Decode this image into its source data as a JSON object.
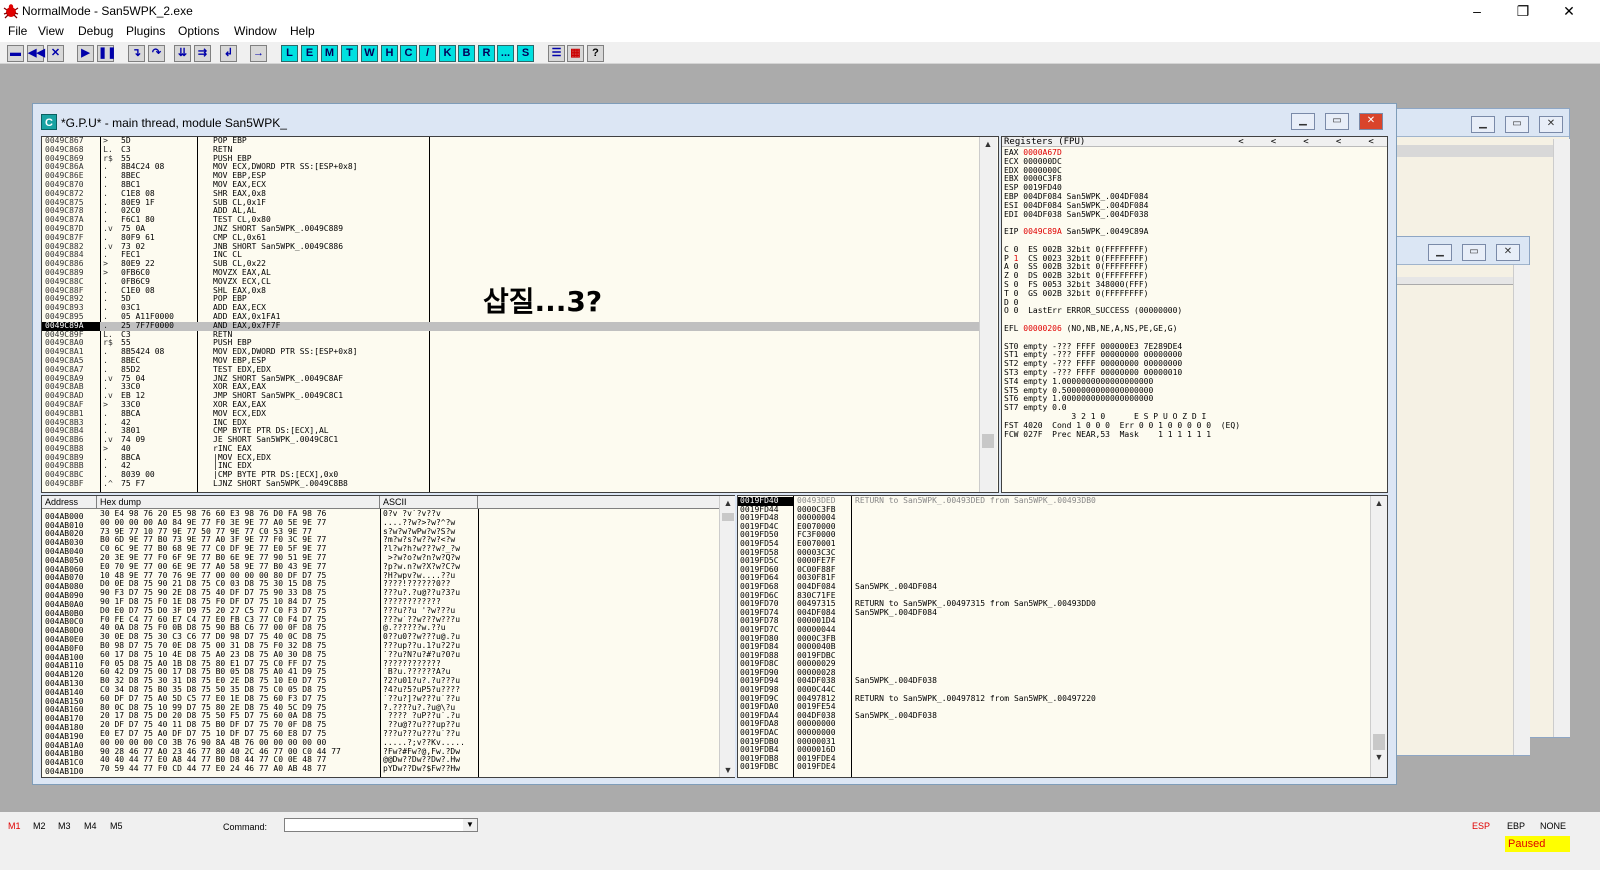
{
  "window": {
    "title": "NormalMode - San5WPK_2.exe",
    "minimize": "–",
    "maximize": "❐",
    "close": "✕"
  },
  "menu": [
    "File",
    "View",
    "Debug",
    "Plugins",
    "Options",
    "Window",
    "Help"
  ],
  "toolbar": {
    "left_buttons": [
      "open-icon",
      "rewind-icon",
      "close-icon",
      "run-icon",
      "pause-icon",
      "step-into-icon",
      "step-over-icon",
      "trace-into-icon",
      "trace-over-icon",
      "execute-till-return-icon",
      "go-to-icon"
    ],
    "letters": [
      "L",
      "E",
      "M",
      "T",
      "W",
      "H",
      "C",
      "/",
      "K",
      "B",
      "R",
      "...",
      "S"
    ],
    "right_buttons": [
      "list-icon",
      "grid-icon",
      "help-icon"
    ],
    "help_label": "?"
  },
  "cpu_window": {
    "title": "*G.P.U* - main thread, module San5WPK_",
    "icon_letter": "C"
  },
  "overlay_text": "삽질...3?",
  "disasm": [
    {
      "addr": "0049C867",
      "arrow": "> ",
      "hex": "5D",
      "asm": "POP EBP"
    },
    {
      "addr": "0049C868",
      "arrow": "L.",
      "hex": "C3",
      "asm": "RETN"
    },
    {
      "addr": "0049C869",
      "arrow": "r$",
      "hex": "55",
      "asm": "PUSH EBP"
    },
    {
      "addr": "0049C86A",
      "arrow": ". ",
      "hex": "8B4C24 08",
      "asm": "MOV ECX,DWORD PTR SS:[ESP+0x8]"
    },
    {
      "addr": "0049C86E",
      "arrow": ". ",
      "hex": "8BEC",
      "asm": "MOV EBP,ESP"
    },
    {
      "addr": "0049C870",
      "arrow": ". ",
      "hex": "8BC1",
      "asm": "MOV EAX,ECX"
    },
    {
      "addr": "0049C872",
      "arrow": ". ",
      "hex": "C1E8 08",
      "asm": "SHR EAX,0x8"
    },
    {
      "addr": "0049C875",
      "arrow": ". ",
      "hex": "80E9 1F",
      "asm": "SUB CL,0x1F"
    },
    {
      "addr": "0049C878",
      "arrow": ". ",
      "hex": "02C0",
      "asm": "ADD AL,AL"
    },
    {
      "addr": "0049C87A",
      "arrow": ". ",
      "hex": "F6C1 80",
      "asm": "TEST CL,0x80"
    },
    {
      "addr": "0049C87D",
      "arrow": ".v",
      "hex": "75 0A",
      "asm": "JNZ SHORT San5WPK_.0049C889"
    },
    {
      "addr": "0049C87F",
      "arrow": ". ",
      "hex": "80F9 61",
      "asm": "CMP CL,0x61"
    },
    {
      "addr": "0049C882",
      "arrow": ".v",
      "hex": "73 02",
      "asm": "JNB SHORT San5WPK_.0049C886"
    },
    {
      "addr": "0049C884",
      "arrow": ". ",
      "hex": "FEC1",
      "asm": "INC CL"
    },
    {
      "addr": "0049C886",
      "arrow": "> ",
      "hex": "80E9 22",
      "asm": "SUB CL,0x22"
    },
    {
      "addr": "0049C889",
      "arrow": "> ",
      "hex": "0FB6C0",
      "asm": "MOVZX EAX,AL"
    },
    {
      "addr": "0049C88C",
      "arrow": ". ",
      "hex": "0FB6C9",
      "asm": "MOVZX ECX,CL"
    },
    {
      "addr": "0049C88F",
      "arrow": ". ",
      "hex": "C1E0 08",
      "asm": "SHL EAX,0x8"
    },
    {
      "addr": "0049C892",
      "arrow": ". ",
      "hex": "5D",
      "asm": "POP EBP"
    },
    {
      "addr": "0049C893",
      "arrow": ". ",
      "hex": "03C1",
      "asm": "ADD EAX,ECX"
    },
    {
      "addr": "0049C895",
      "arrow": ". ",
      "hex": "05 A11F0000",
      "asm": "ADD EAX,0x1FA1"
    },
    {
      "addr": "0049C89A",
      "arrow": ". ",
      "hex": "25 7F7F0000",
      "asm": "AND EAX,0x7F7F",
      "sel": true
    },
    {
      "addr": "0049C89F",
      "arrow": "L.",
      "hex": "C3",
      "asm": "RETN"
    },
    {
      "addr": "0049C8A0",
      "arrow": "r$",
      "hex": "55",
      "asm": "PUSH EBP"
    },
    {
      "addr": "0049C8A1",
      "arrow": ". ",
      "hex": "8B5424 08",
      "asm": "MOV EDX,DWORD PTR SS:[ESP+0x8]"
    },
    {
      "addr": "0049C8A5",
      "arrow": ". ",
      "hex": "8BEC",
      "asm": "MOV EBP,ESP"
    },
    {
      "addr": "0049C8A7",
      "arrow": ". ",
      "hex": "85D2",
      "asm": "TEST EDX,EDX"
    },
    {
      "addr": "0049C8A9",
      "arrow": ".v",
      "hex": "75 04",
      "asm": "JNZ SHORT San5WPK_.0049C8AF"
    },
    {
      "addr": "0049C8AB",
      "arrow": ". ",
      "hex": "33C0",
      "asm": "XOR EAX,EAX"
    },
    {
      "addr": "0049C8AD",
      "arrow": ".v",
      "hex": "EB 12",
      "asm": "JMP SHORT San5WPK_.0049C8C1"
    },
    {
      "addr": "0049C8AF",
      "arrow": "> ",
      "hex": "33C0",
      "asm": "XOR EAX,EAX"
    },
    {
      "addr": "0049C8B1",
      "arrow": ". ",
      "hex": "8BCA",
      "asm": "MOV ECX,EDX"
    },
    {
      "addr": "0049C8B3",
      "arrow": ". ",
      "hex": "42",
      "asm": "INC EDX"
    },
    {
      "addr": "0049C8B4",
      "arrow": ". ",
      "hex": "3801",
      "asm": "CMP BYTE PTR DS:[ECX],AL"
    },
    {
      "addr": "0049C8B6",
      "arrow": ".v",
      "hex": "74 09",
      "asm": "JE SHORT San5WPK_.0049C8C1"
    },
    {
      "addr": "0049C8B8",
      "arrow": "> ",
      "hex": "40",
      "asm": "rINC EAX"
    },
    {
      "addr": "0049C8B9",
      "arrow": ". ",
      "hex": "8BCA",
      "asm": "|MOV ECX,EDX"
    },
    {
      "addr": "0049C8BB",
      "arrow": ". ",
      "hex": "42",
      "asm": "|INC EDX"
    },
    {
      "addr": "0049C8BC",
      "arrow": ". ",
      "hex": "8039 00",
      "asm": "|CMP BYTE PTR DS:[ECX],0x0"
    },
    {
      "addr": "0049C8BF",
      "arrow": ".^",
      "hex": "75 F7",
      "asm": "LJNZ SHORT San5WPK_.0049C8B8"
    }
  ],
  "registers": {
    "header": "Registers (FPU)",
    "lines": [
      [
        "EAX ",
        "0000A67D",
        ""
      ],
      [
        "ECX 000000DC",
        "",
        ""
      ],
      [
        "EDX 0000000C",
        "",
        ""
      ],
      [
        "EBX 0000C3F8",
        "",
        ""
      ],
      [
        "ESP 0019FD40",
        "",
        ""
      ],
      [
        "EBP 004DF084 San5WPK_.004DF084",
        "",
        ""
      ],
      [
        "ESI 004DF084 San5WPK_.004DF084",
        "",
        ""
      ],
      [
        "EDI 004DF038 San5WPK_.004DF038",
        "",
        ""
      ],
      [
        "",
        "",
        ""
      ],
      [
        "EIP ",
        "0049C89A",
        " San5WPK_.0049C89A"
      ],
      [
        "",
        "",
        ""
      ],
      [
        "C 0  ES 002B 32bit 0(FFFFFFFF)",
        "",
        ""
      ],
      [
        "P ",
        "1",
        "  CS 0023 32bit 0(FFFFFFFF)"
      ],
      [
        "A 0  SS 002B 32bit 0(FFFFFFFF)",
        "",
        ""
      ],
      [
        "Z 0  DS 002B 32bit 0(FFFFFFFF)",
        "",
        ""
      ],
      [
        "S 0  FS 0053 32bit 348000(FFF)",
        "",
        ""
      ],
      [
        "T 0  GS 002B 32bit 0(FFFFFFFF)",
        "",
        ""
      ],
      [
        "D 0",
        "",
        ""
      ],
      [
        "O 0  LastErr ERROR_SUCCESS (00000000)",
        "",
        ""
      ],
      [
        "",
        "",
        ""
      ],
      [
        "EFL ",
        "00000206",
        " (NO,NB,NE,A,NS,PE,GE,G)"
      ],
      [
        "",
        "",
        ""
      ],
      [
        "ST0 empty -??? FFFF 000000E3 7E289DE4",
        "",
        ""
      ],
      [
        "ST1 empty -??? FFFF 00000000 00000000",
        "",
        ""
      ],
      [
        "ST2 empty -??? FFFF 00000000 00000000",
        "",
        ""
      ],
      [
        "ST3 empty -??? FFFF 00000000 00000010",
        "",
        ""
      ],
      [
        "ST4 empty 1.0000000000000000000",
        "",
        ""
      ],
      [
        "ST5 empty 0.5000000000000000000",
        "",
        ""
      ],
      [
        "ST6 empty 1.0000000000000000000",
        "",
        ""
      ],
      [
        "ST7 empty 0.0",
        "",
        ""
      ],
      [
        "              3 2 1 0      E S P U O Z D I",
        "",
        ""
      ],
      [
        "FST 4020  Cond 1 0 0 0  Err 0 0 1 0 0 0 0 0  (EQ)",
        "",
        ""
      ],
      [
        "FCW 027F  Prec NEAR,53  Mask    1 1 1 1 1 1",
        "",
        ""
      ]
    ]
  },
  "dump": {
    "col_address": "Address",
    "col_hex": "Hex dump",
    "col_ascii": "ASCII",
    "rows": [
      [
        "004AB000",
        "30 E4 98 76 20 E5 98 76 60 E3 98 76 D0 FA 98 76",
        "0?v ?v`?v??v"
      ],
      [
        "004AB010",
        "00 00 00 00 A0 84 9E 77 F0 3E 9E 77 A0 5E 9E 77",
        "....??w?>?w?^?w"
      ],
      [
        "004AB020",
        "73 9E 77 10 77 9E 77 50 77 9E 77 C0 53 9E 77",
        "s?w?w?wPw?w?S?w"
      ],
      [
        "004AB030",
        "B0 6D 9E 77 B0 73 9E 77 A0 3F 9E 77 F0 3C 9E 77",
        "?m?w?s?w??w?<?w"
      ],
      [
        "004AB040",
        "C0 6C 9E 77 B0 68 9E 77 C0 DF 9E 77 E0 5F 9E 77",
        "?l?w?h?w???w?_?w"
      ],
      [
        "004AB050",
        "20 3E 9E 77 F0 6F 9E 77 B0 6E 9E 77 90 51 9E 77",
        " >?w?o?w?n?w?Q?w"
      ],
      [
        "004AB060",
        "E0 70 9E 77 00 6E 9E 77 A0 58 9E 77 B0 43 9E 77",
        "?p?w.n?w?X?w?C?w"
      ],
      [
        "004AB070",
        "10 48 9E 77 70 76 9E 77 00 00 00 00 80 DF D7 75",
        "?H?wpv?w....??u"
      ],
      [
        "004AB080",
        "D0 0E D8 75 90 21 D8 75 C0 03 D8 75 30 15 D8 75",
        "????!??????0??"
      ],
      [
        "004AB090",
        "90 F3 D7 75 90 2E D8 75 40 DF D7 75 90 33 D8 75",
        "???u?.?u@??u?3?u"
      ],
      [
        "004AB0A0",
        "90 1F D8 75 F0 1E D8 75 F0 DF D7 75 10 84 D7 75",
        "????????????"
      ],
      [
        "004AB0B0",
        "D0 E0 D7 75 D0 3F D9 75 20 27 C5 77 C0 F3 D7 75",
        "???u??u '?w???u"
      ],
      [
        "004AB0C0",
        "F0 FE C4 77 60 E7 C4 77 E0 FB C3 77 C0 F4 D7 75",
        "???w`??w???w???u"
      ],
      [
        "004AB0D0",
        "40 0A D8 75 F0 0B D8 75 90 B8 C6 77 00 0F D8 75",
        "@.??????w.??u"
      ],
      [
        "004AB0E0",
        "30 0E D8 75 30 C3 C6 77 D0 98 D7 75 40 0C D8 75",
        "0??u0??w???u@.?u"
      ],
      [
        "004AB0F0",
        "B0 98 D7 75 70 0E D8 75 00 31 D8 75 F0 32 D8 75",
        "???up??u.1?u?2?u"
      ],
      [
        "004AB100",
        "60 17 D8 75 10 4E D8 75 A0 23 D8 75 A0 30 D8 75",
        "`??u?N?u?#?u?0?u"
      ],
      [
        "004AB110",
        "F0 05 D8 75 A0 1B D8 75 80 E1 D7 75 C0 FF D7 75",
        "????????????"
      ],
      [
        "004AB120",
        "60 42 D9 75 00 17 D8 75 B0 05 D8 75 A0 41 D9 75",
        "`B?u.??????A?u"
      ],
      [
        "004AB130",
        "B0 32 D8 75 30 31 D8 75 E0 2E D8 75 10 E0 D7 75",
        "?2?u01?u?.?u???u"
      ],
      [
        "004AB140",
        "C0 34 D8 75 B0 35 D8 75 50 35 D8 75 C0 05 D8 75",
        "?4?u?5?uP5?u????"
      ],
      [
        "004AB150",
        "60 DF D7 75 A0 5D C5 77 E0 1E D8 75 60 F3 D7 75",
        "`??u?]?w???u`??u"
      ],
      [
        "004AB160",
        "80 0C D8 75 10 99 D7 75 80 2E D8 75 40 5C D9 75",
        "?.????u?.?u@\\?u"
      ],
      [
        "004AB170",
        "20 17 D8 75 D0 20 D8 75 50 F5 D7 75 60 0A D8 75",
        " ???? ?uP??u`.?u"
      ],
      [
        "004AB180",
        "20 DF D7 75 40 11 D8 75 B0 DF D7 75 70 0F D8 75",
        " ??u@??u???up??u"
      ],
      [
        "004AB190",
        "E0 E7 D7 75 A0 DF D7 75 10 DF D7 75 60 E8 D7 75",
        "???u???u???u`??u"
      ],
      [
        "004AB1A0",
        "00 00 00 00 C0 3B 76 90 8A 4B 76 00 00 00 00 00",
        ".....?;v??Kv....."
      ],
      [
        "004AB1B0",
        "90 28 46 77 A0 23 46 77 80 40 2C 46 77 00 C0 44 77",
        "?Fw?#Fw?@,Fw.?Dw"
      ],
      [
        "004AB1C0",
        "40 40 44 77 E0 A8 44 77 B0 D8 44 77 C0 0E 48 77",
        "@@Dw??Dw??Dw?.Hw"
      ],
      [
        "004AB1D0",
        "70 59 44 77 F0 CD 44 77 E0 24 46 77 A0 AB 48 77",
        "pYDw??Dw?$Fw??Hw"
      ]
    ]
  },
  "stack": {
    "rows": [
      [
        "0019FD40",
        "00493DED",
        "RETURN to San5WPK_.00493DED from San5WPK_.00493DB0"
      ],
      [
        "0019FD44",
        "0000C3FB",
        ""
      ],
      [
        "0019FD48",
        "00000004",
        ""
      ],
      [
        "0019FD4C",
        "E0070000",
        ""
      ],
      [
        "0019FD50",
        "FC3F0000",
        ""
      ],
      [
        "0019FD54",
        "E0070001",
        ""
      ],
      [
        "0019FD58",
        "00003C3C",
        ""
      ],
      [
        "0019FD5C",
        "0000FE7F",
        ""
      ],
      [
        "0019FD60",
        "0C00F88F",
        ""
      ],
      [
        "0019FD64",
        "0030F81F",
        ""
      ],
      [
        "0019FD68",
        "004DF084",
        "San5WPK_.004DF084"
      ],
      [
        "0019FD6C",
        "830C71FE",
        ""
      ],
      [
        "0019FD70",
        "00497315",
        "RETURN to San5WPK_.00497315 from San5WPK_.00493DD0"
      ],
      [
        "0019FD74",
        "004DF084",
        "San5WPK_.004DF084"
      ],
      [
        "0019FD78",
        "000001D4",
        ""
      ],
      [
        "0019FD7C",
        "00000044",
        ""
      ],
      [
        "0019FD80",
        "0000C3FB",
        ""
      ],
      [
        "0019FD84",
        "0000040B",
        ""
      ],
      [
        "0019FD88",
        "0019FDBC",
        ""
      ],
      [
        "0019FD8C",
        "00000029",
        ""
      ],
      [
        "0019FD90",
        "00000028",
        ""
      ],
      [
        "0019FD94",
        "004DF038",
        "San5WPK_.004DF038"
      ],
      [
        "0019FD98",
        "0000C44C",
        ""
      ],
      [
        "0019FD9C",
        "00497812",
        "RETURN to San5WPK_.00497812 from San5WPK_.00497220"
      ],
      [
        "0019FDA0",
        "0019FE54",
        ""
      ],
      [
        "0019FDA4",
        "004DF038",
        "San5WPK_.004DF038"
      ],
      [
        "0019FDA8",
        "00000000",
        ""
      ],
      [
        "0019FDAC",
        "00000000",
        ""
      ],
      [
        "0019FDB0",
        "00000031",
        ""
      ],
      [
        "0019FDB4",
        "0000016D",
        ""
      ],
      [
        "0019FDB8",
        "0019FDE4",
        ""
      ],
      [
        "0019FDBC",
        "0019FDE4",
        ""
      ]
    ]
  },
  "status": {
    "mtabs": [
      "M1",
      "M2",
      "M3",
      "M4",
      "M5"
    ],
    "command_label": "Command:",
    "command_value": "",
    "reg_tabs": [
      "ESP",
      "EBP",
      "NONE"
    ],
    "state": "Paused"
  },
  "colors": {
    "accent_red": "#e00000",
    "letter_buttons": "#00e0e0",
    "pane_bg": "#fdfbf0",
    "mdi_bg": "#ababab",
    "paused_bg": "#ffff00"
  }
}
